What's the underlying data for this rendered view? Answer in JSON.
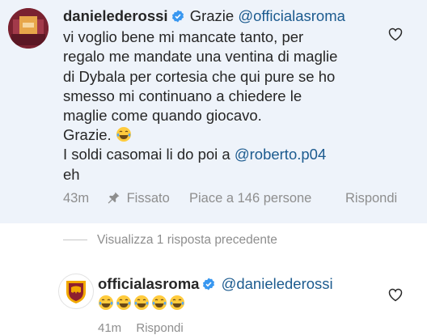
{
  "comment": {
    "username": "danielederossi",
    "first_word": "Grazie",
    "mention_1": "@officialasroma",
    "lines": [
      "vi voglio bene mi mancate tanto, per",
      "regalo me mandate una ventina di maglie",
      "di Dybala per cortesia che qui pure se ho",
      "smesso mi continuano a chiedere le",
      "maglie come quando giocavo."
    ],
    "thanks": "Grazie.",
    "money_prefix": "I soldi casomai li do poi a",
    "mention_2": "@roberto.p04",
    "tail": "eh",
    "time": "43m",
    "pinned_label": "Fissato",
    "likes": "Piace a 146 persone",
    "reply_label": "Rispondi"
  },
  "view_replies": "Visualizza 1 risposta precedente",
  "reply": {
    "username": "officialasroma",
    "mention": "@danielederossi",
    "emoji_name": "face-with-tears-of-joy",
    "emoji_count": 5,
    "time": "41m",
    "reply_label": "Rispondi"
  },
  "colors": {
    "pinned_background": "#eef3fa",
    "mention": "#1c5b8f",
    "verified": "#3897f0",
    "muted": "#8e8e8e"
  }
}
